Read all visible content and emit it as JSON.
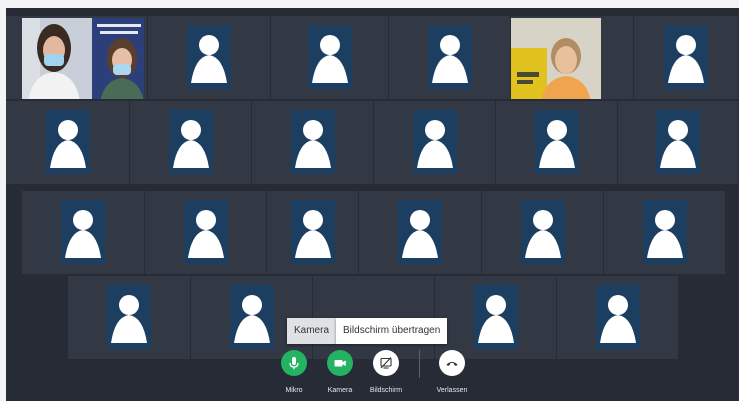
{
  "participants": {
    "row1": [
      "video-two-women",
      "avatar",
      "avatar",
      "avatar",
      "video-woman-yellow",
      "avatar"
    ],
    "row2": [
      "avatar",
      "avatar",
      "avatar",
      "avatar",
      "avatar",
      "avatar"
    ],
    "row3": [
      "avatar",
      "avatar",
      "avatar",
      "avatar",
      "avatar",
      "avatar"
    ],
    "row4": [
      "avatar",
      "avatar",
      "avatar",
      "avatar",
      "avatar"
    ]
  },
  "tooltip": {
    "kamera": "Kamera",
    "screen_share": "Bildschirm übertragen"
  },
  "controls": {
    "mic_label": "Mikro",
    "camera_label": "Kamera",
    "screen_label": "Bildschirm",
    "leave_label": "Verlassen"
  },
  "colors": {
    "background": "#262b35",
    "tile": "#323844",
    "avatar_bg": "#1c3f61",
    "control_green": "#24b362"
  },
  "icons": [
    "mic-icon",
    "video-camera-icon",
    "screen-share-off-icon",
    "hang-up-icon",
    "person-avatar-icon"
  ]
}
